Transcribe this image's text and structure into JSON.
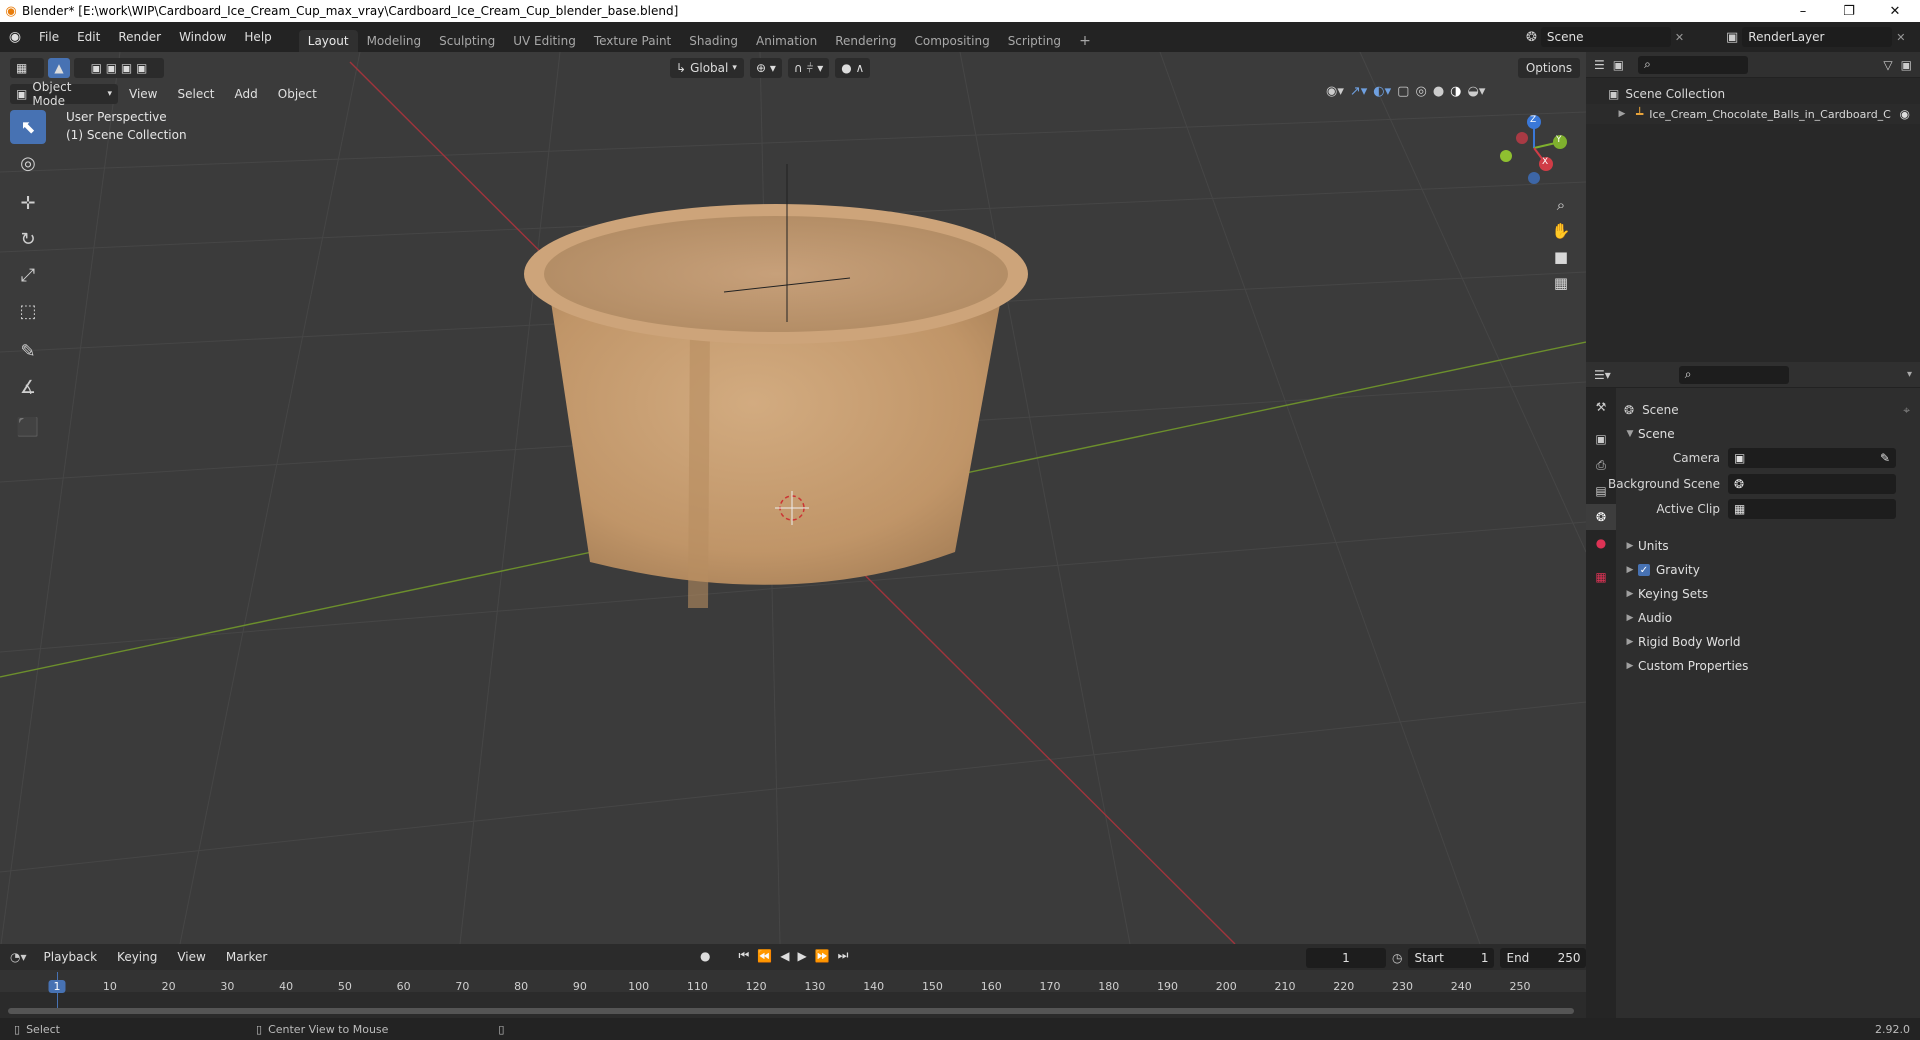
{
  "window": {
    "title": "Blender* [E:\\work\\WIP\\Cardboard_Ice_Cream_Cup_max_vray\\Cardboard_Ice_Cream_Cup_blender_base.blend]",
    "minimize": "–",
    "restore": "❐",
    "close": "✕"
  },
  "menu": {
    "items": [
      "File",
      "Edit",
      "Render",
      "Window",
      "Help"
    ]
  },
  "workspaces": {
    "tabs": [
      "Layout",
      "Modeling",
      "Sculpting",
      "UV Editing",
      "Texture Paint",
      "Shading",
      "Animation",
      "Rendering",
      "Compositing",
      "Scripting"
    ],
    "active": "Layout",
    "add": "+"
  },
  "topbar": {
    "scene": "Scene",
    "render_layer": "RenderLayer"
  },
  "viewport_header": {
    "transform_orientation": "Global",
    "options": "Options",
    "mode": "Object Mode",
    "menus": [
      "View",
      "Select",
      "Add",
      "Object"
    ]
  },
  "viewport": {
    "perspective": "User Perspective",
    "collection": "(1) Scene Collection",
    "axis_x": "X",
    "axis_y": "Y",
    "axis_z": "Z"
  },
  "outliner": {
    "root": "Scene Collection",
    "object": "Ice_Cream_Chocolate_Balls_in_Cardboard_C"
  },
  "properties": {
    "context": "Scene",
    "panel": "Scene",
    "fields": [
      {
        "label": "Camera",
        "value": ""
      },
      {
        "label": "Background Scene",
        "value": ""
      },
      {
        "label": "Active Clip",
        "value": ""
      }
    ],
    "subpanels": [
      "Units",
      "Gravity",
      "Keying Sets",
      "Audio",
      "Rigid Body World",
      "Custom Properties"
    ],
    "gravity_checked": true
  },
  "timeline": {
    "menus": [
      "Playback",
      "Keying",
      "View",
      "Marker"
    ],
    "current_frame": "1",
    "start_label": "Start",
    "start": "1",
    "end_label": "End",
    "end": "250",
    "ticks": [
      "1",
      "10",
      "20",
      "30",
      "40",
      "50",
      "60",
      "70",
      "80",
      "90",
      "100",
      "110",
      "120",
      "130",
      "140",
      "150",
      "160",
      "170",
      "180",
      "190",
      "200",
      "210",
      "220",
      "230",
      "240",
      "250"
    ]
  },
  "status": {
    "select": "Select",
    "center_view": "Center View to Mouse",
    "version": "2.92.0"
  },
  "colors": {
    "accent": "#4772b3",
    "x_axis": "#d03c46",
    "y_axis": "#7fb02e",
    "z_axis": "#3a78d8",
    "cup": "#c49a6c"
  }
}
